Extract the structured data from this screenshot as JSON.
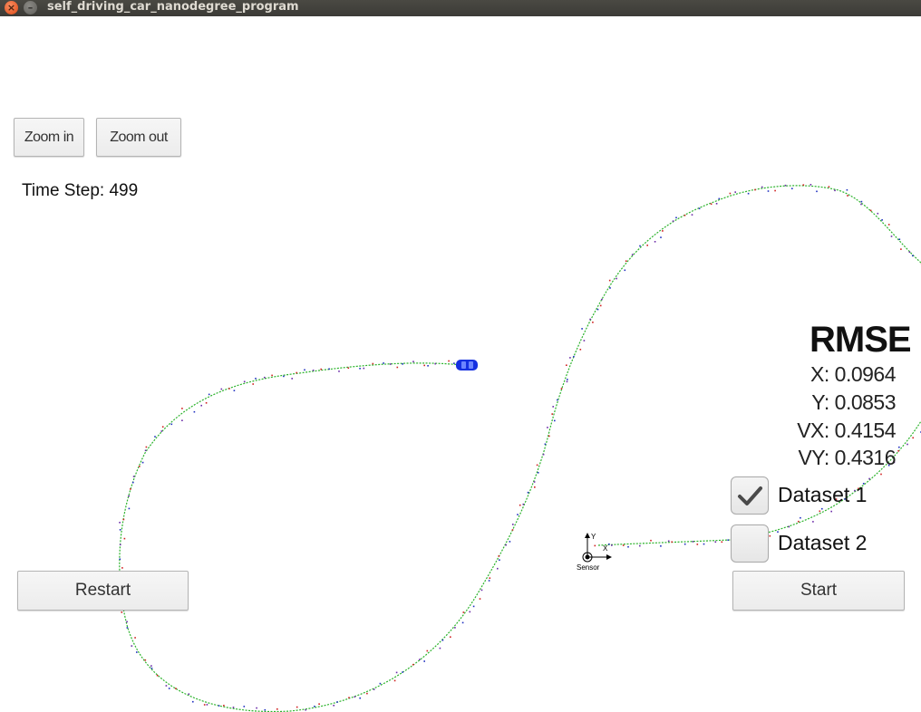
{
  "window": {
    "title": "self_driving_car_nanodegree_program",
    "close_glyph": "×",
    "min_glyph": "–"
  },
  "controls": {
    "zoom_in_label": "Zoom in",
    "zoom_out_label": "Zoom out",
    "restart_label": "Restart",
    "start_label": "Start"
  },
  "status": {
    "time_step": "Time Step: 499"
  },
  "rmse": {
    "title": "RMSE",
    "x": "X: 0.0964",
    "y": "Y: 0.0853",
    "vx": "VX: 0.4154",
    "vy": "VY: 0.4316"
  },
  "datasets": [
    {
      "label": "Dataset 1",
      "checked": true
    },
    {
      "label": "Dataset 2",
      "checked": false
    }
  ],
  "sensor": {
    "label": "Sensor",
    "axis_x": "X",
    "axis_y": "Y"
  },
  "icons": [
    "close-icon",
    "minimize-icon",
    "checkmark-icon",
    "car-icon",
    "sensor-origin-icon"
  ],
  "colors": {
    "track": "#2bb32b",
    "lidar_marker": "#d02020",
    "radar_marker": "#2030c0",
    "estimate_marker": "#6a2aa8",
    "car": "#1530e0"
  }
}
